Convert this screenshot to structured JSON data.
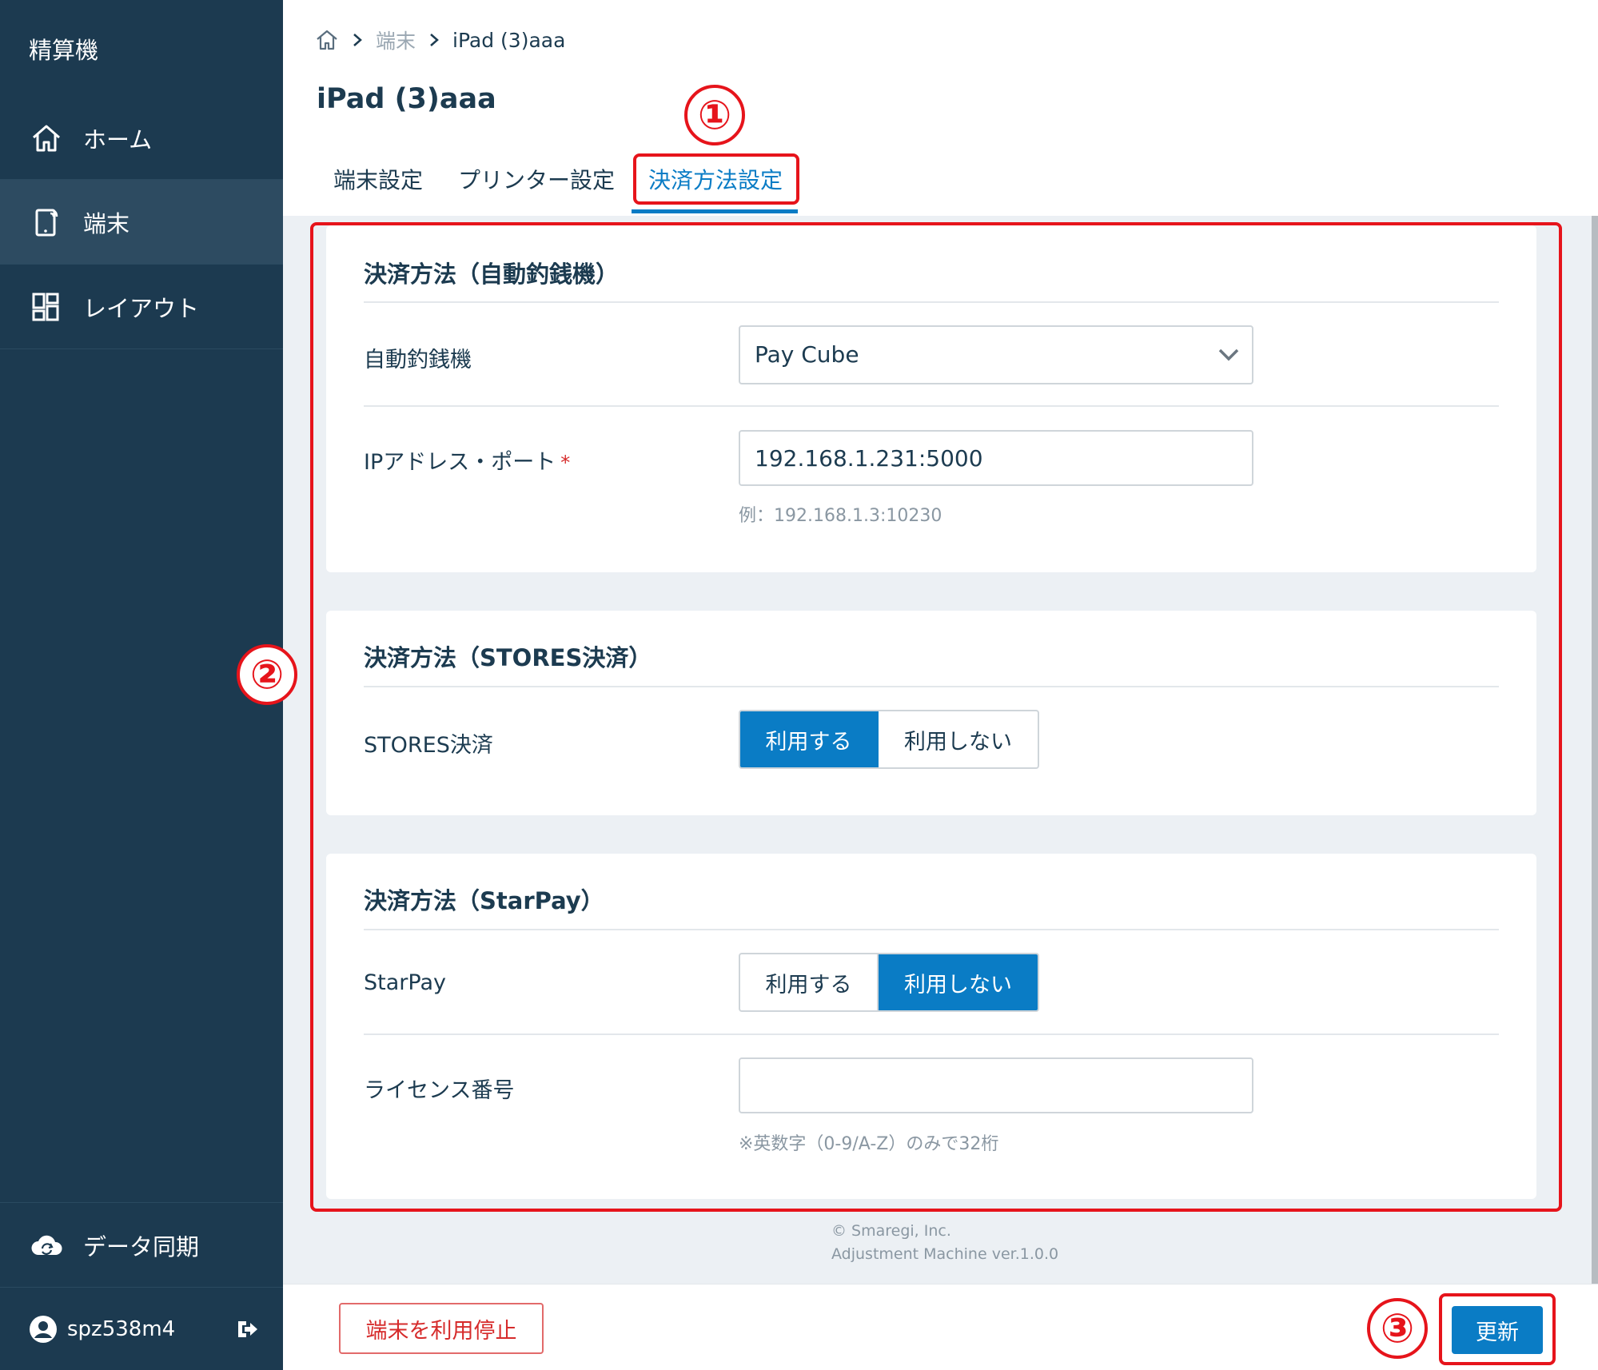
{
  "sidebar": {
    "app_title": "精算機",
    "items": [
      {
        "label": "ホーム",
        "icon": "home-icon"
      },
      {
        "label": "端末",
        "icon": "tablet-icon"
      },
      {
        "label": "レイアウト",
        "icon": "layout-icon"
      }
    ],
    "sync_label": "データ同期",
    "username": "spz538m4"
  },
  "breadcrumb": {
    "link": "端末",
    "current": "iPad (3)aaa"
  },
  "page_title": "iPad (3)aaa",
  "tabs": [
    {
      "label": "端末設定"
    },
    {
      "label": "プリンター設定"
    },
    {
      "label": "決済方法設定"
    }
  ],
  "sections": {
    "changer": {
      "title": "決済方法（自動釣銭機）",
      "machine_label": "自動釣銭機",
      "machine_value": "Pay Cube",
      "ip_label": "IPアドレス・ポート",
      "ip_required": "*",
      "ip_value": "192.168.1.231:5000",
      "ip_hint": "例：192.168.1.3:10230"
    },
    "stores": {
      "title": "決済方法（STORES決済）",
      "label": "STORES決済",
      "use": "利用する",
      "no_use": "利用しない",
      "selected": "use"
    },
    "starpay": {
      "title": "決済方法（StarPay）",
      "label": "StarPay",
      "use": "利用する",
      "no_use": "利用しない",
      "selected": "no_use",
      "license_label": "ライセンス番号",
      "license_value": "",
      "license_hint": "※英数字（0-9/A-Z）のみで32桁"
    }
  },
  "footer": {
    "copyright": "© Smaregi, Inc.",
    "version": "Adjustment Machine ver.1.0.0"
  },
  "actions": {
    "stop_label": "端末を利用停止",
    "update_label": "更新"
  },
  "annotations": [
    "①",
    "②",
    "③"
  ],
  "colors": {
    "sidebar_bg": "#1c3a50",
    "accent": "#0a7cc5",
    "annotation": "#e6141b",
    "danger": "#d62b2b"
  }
}
